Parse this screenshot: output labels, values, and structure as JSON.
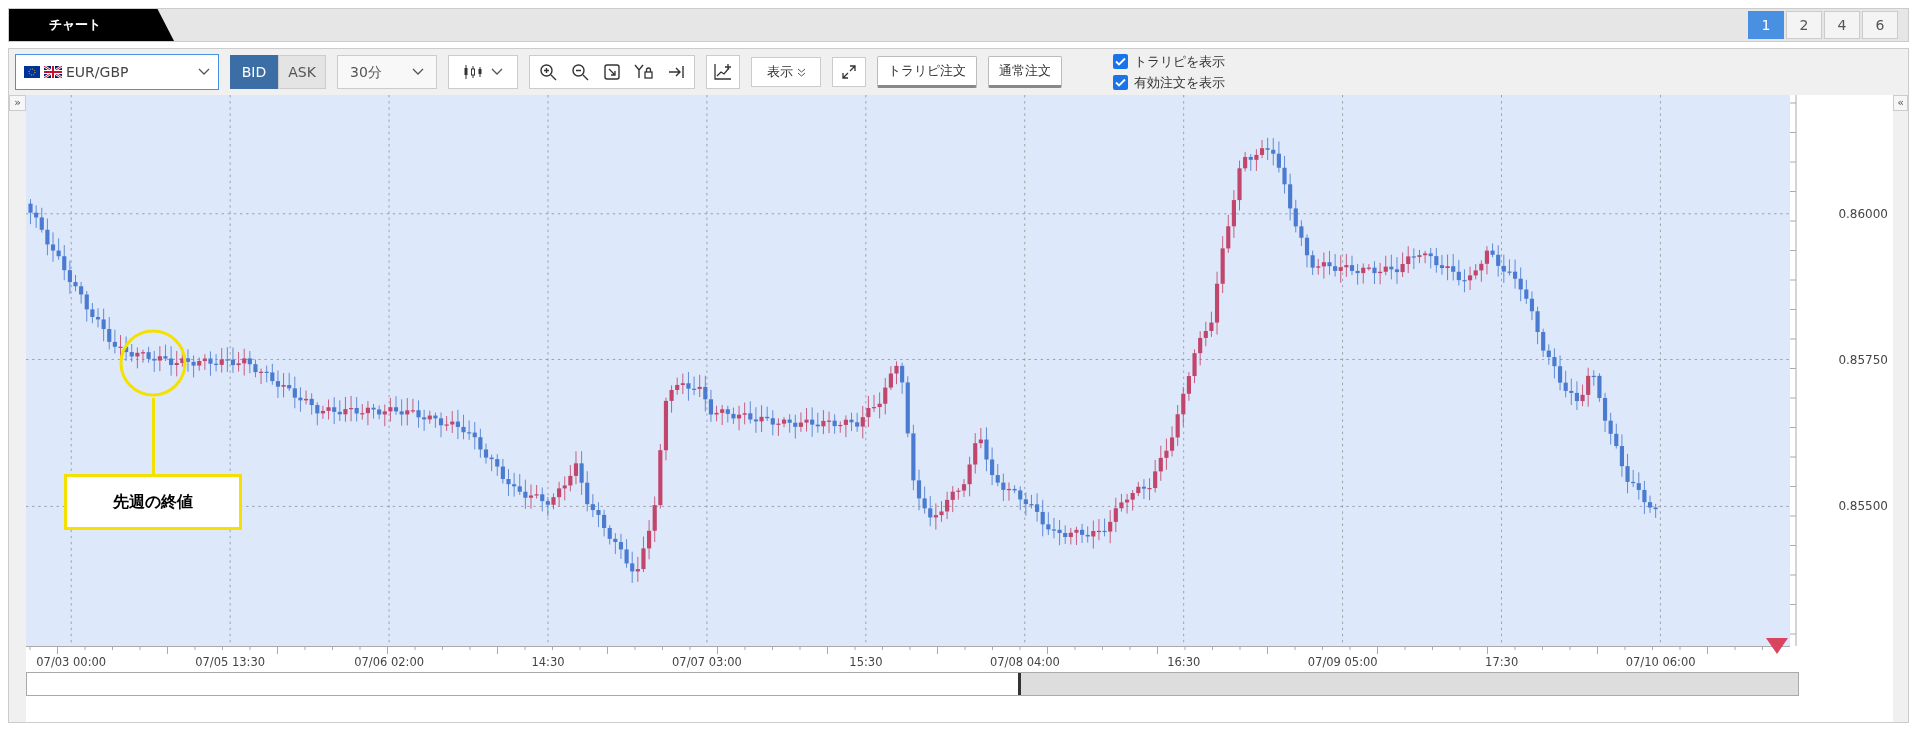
{
  "header": {
    "tab": "チャート",
    "layouts": [
      {
        "label": "1",
        "selected": true
      },
      {
        "label": "2",
        "selected": false
      },
      {
        "label": "4",
        "selected": false
      },
      {
        "label": "6",
        "selected": false
      }
    ]
  },
  "toolbar": {
    "pair": "EUR/GBP",
    "sides": [
      {
        "label": "BID",
        "selected": true
      },
      {
        "label": "ASK",
        "selected": false
      }
    ],
    "interval": "30分",
    "display": "表示",
    "orders": [
      "トラリピ注文",
      "通常注文"
    ],
    "options": [
      {
        "label": "トラリピを表示",
        "checked": true
      },
      {
        "label": "有効注文を表示",
        "checked": true
      }
    ]
  },
  "chart": {
    "left_toggle": "»",
    "right_toggle": "«",
    "yticks": [
      "0.86000",
      "0.85750",
      "0.85500"
    ],
    "xticks": [
      "07/03 00:00",
      "07/05 13:30",
      "07/06 02:00",
      "14:30",
      "07/07 03:00",
      "15:30",
      "07/08 04:00",
      "16:30",
      "07/09 05:00",
      "17:30",
      "07/10 06:00"
    ],
    "callout": "先週の終値"
  }
}
